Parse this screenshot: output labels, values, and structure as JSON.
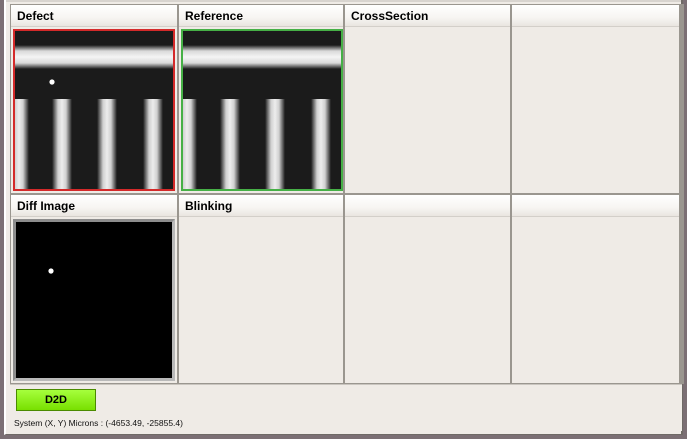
{
  "panels": [
    {
      "title": "Defect"
    },
    {
      "title": "Reference"
    },
    {
      "title": "CrossSection"
    },
    {
      "title": ""
    },
    {
      "title": "Diff Image"
    },
    {
      "title": "Blinking"
    },
    {
      "title": ""
    },
    {
      "title": ""
    }
  ],
  "toolbar": {
    "d2d_label": "D2D"
  },
  "status": {
    "text": "System (X, Y) Microns : (-4653.49, -25855.4)"
  },
  "colors": {
    "defect_border": "#d42a2a",
    "reference_border": "#46b046",
    "d2d_button": "#8cf01a"
  }
}
